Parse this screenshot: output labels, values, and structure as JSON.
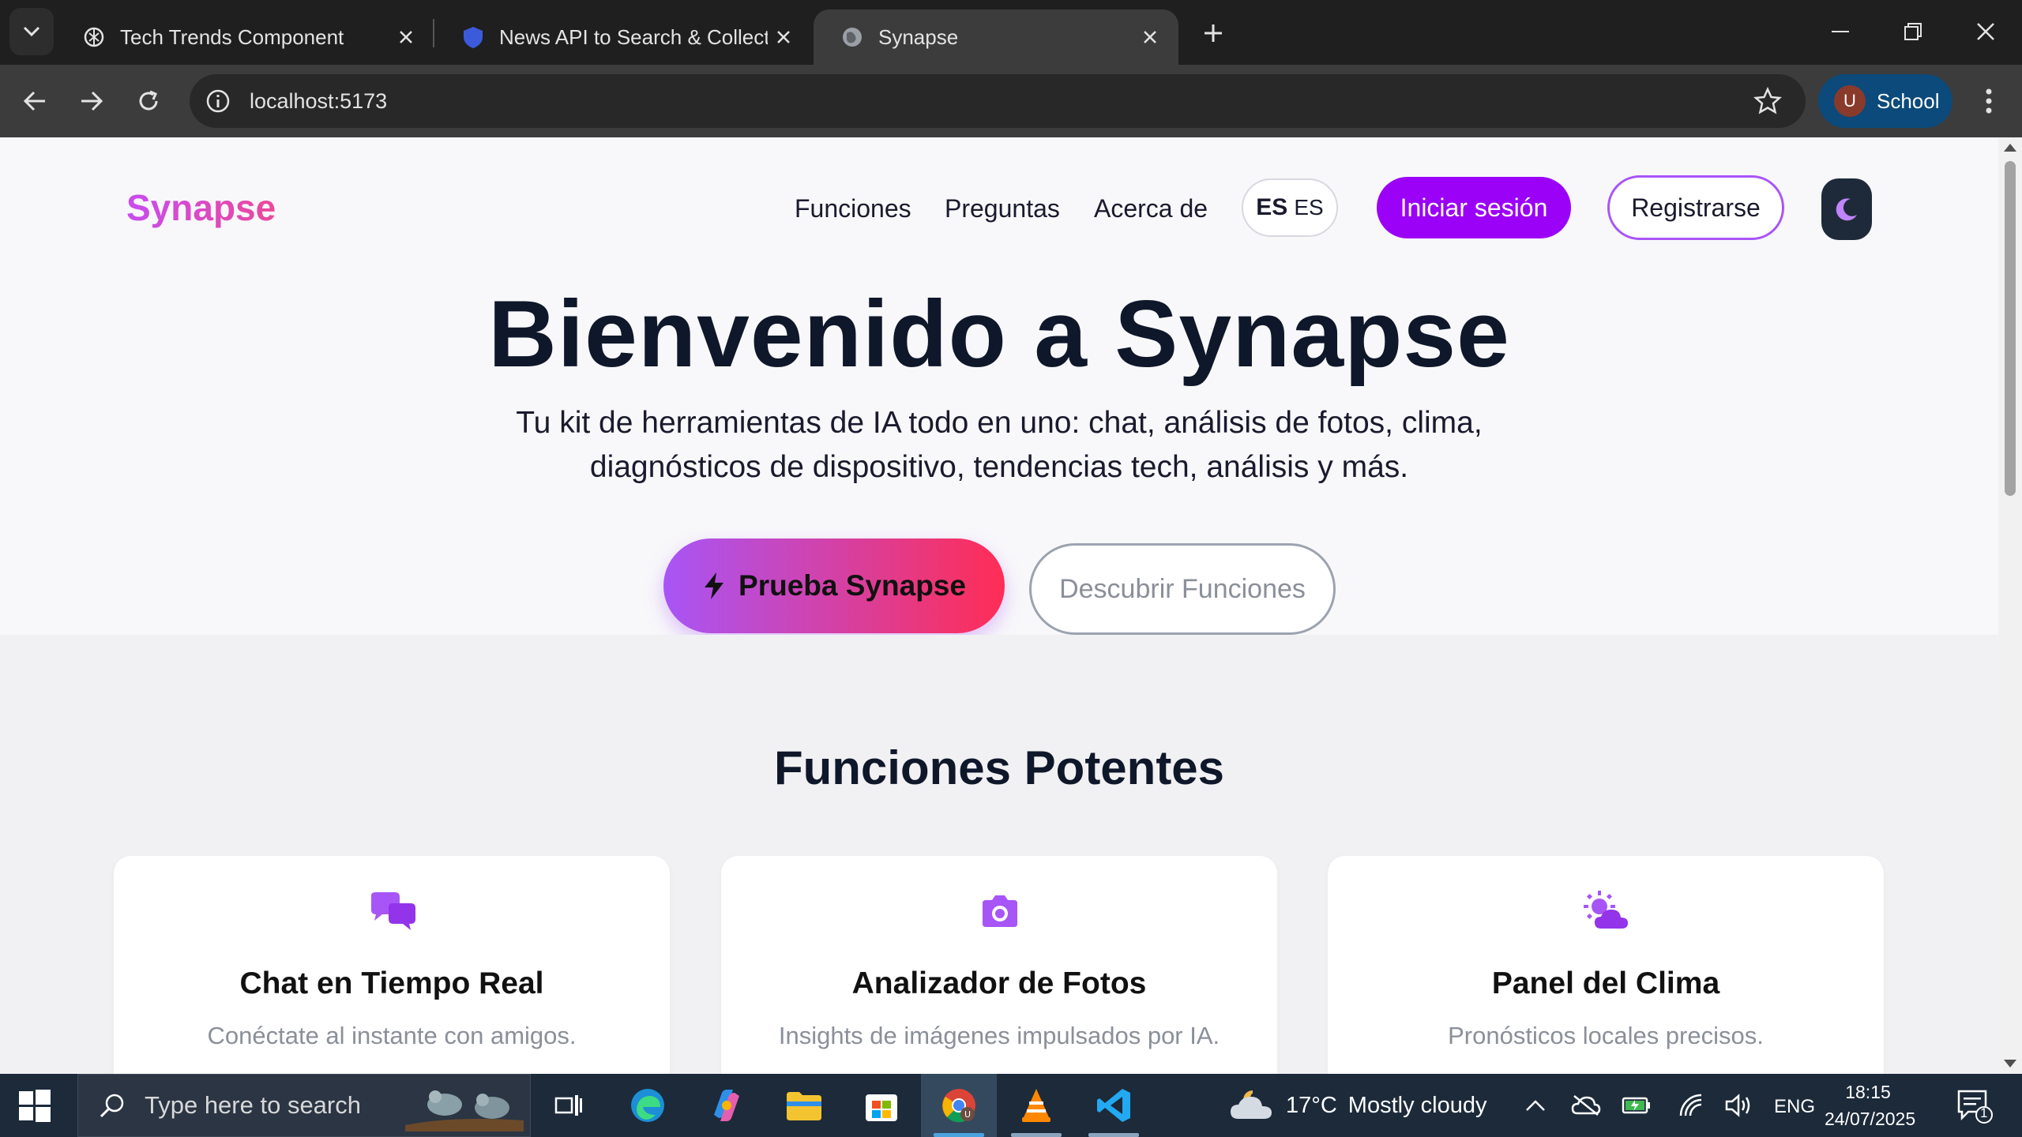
{
  "browser": {
    "tabs": [
      {
        "title": "Tech Trends Component",
        "active": false
      },
      {
        "title": "News API to Search & Collect W",
        "active": false
      },
      {
        "title": "Synapse",
        "active": true
      }
    ],
    "url": "localhost:5173",
    "profile": {
      "initial": "U",
      "name": "School"
    }
  },
  "page": {
    "logo": "Synapse",
    "nav": [
      "Funciones",
      "Preguntas",
      "Acerca de"
    ],
    "lang": {
      "flag": "ES",
      "code": "ES"
    },
    "login_label": "Iniciar sesión",
    "register_label": "Registrarse",
    "hero": {
      "title": "Bienvenido a Synapse",
      "subtitle": "Tu kit de herramientas de IA todo en uno: chat, análisis de fotos, clima, diagnósticos de dispositivo, tendencias tech, análisis y más.",
      "cta_primary": "Prueba Synapse",
      "cta_secondary": "Descubrir Funciones"
    },
    "features": {
      "title": "Funciones Potentes",
      "cards": [
        {
          "icon": "comments-icon",
          "title": "Chat en Tiempo Real",
          "desc": "Conéctate al instante con amigos."
        },
        {
          "icon": "camera-icon",
          "title": "Analizador de Fotos",
          "desc": "Insights de imágenes impulsados por IA."
        },
        {
          "icon": "cloud-sun-icon",
          "title": "Panel del Clima",
          "desc": "Pronósticos locales precisos."
        }
      ]
    },
    "accent_color": "#9b00f7"
  },
  "taskbar": {
    "search_placeholder": "Type here to search",
    "weather": {
      "temp": "17°C",
      "condition": "Mostly cloudy"
    },
    "lang": "ENG",
    "time": "18:15",
    "date": "24/07/2025",
    "notifications": "1"
  }
}
